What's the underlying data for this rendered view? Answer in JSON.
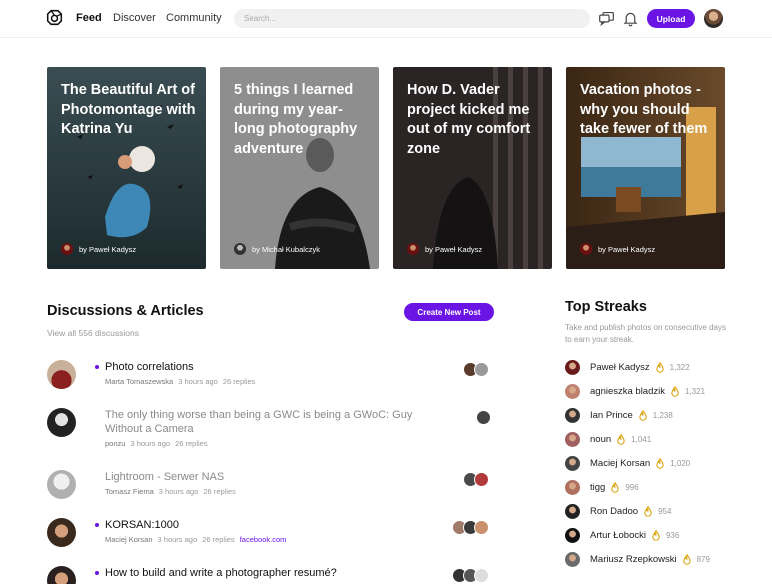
{
  "header": {
    "nav": [
      "Feed",
      "Discover",
      "Community"
    ],
    "search_placeholder": "Search...",
    "upload_label": "Upload"
  },
  "cards": [
    {
      "title": "The Beautiful Art of Photomontage with Katrina Yu",
      "author": "by Paweł Kadysz"
    },
    {
      "title": "5 things I learned during my year-long photography adventure",
      "author": "by Michał Kubalczyk"
    },
    {
      "title": "How D. Vader project kicked me out of my comfort zone",
      "author": "by Paweł Kadysz"
    },
    {
      "title": "Vacation photos - why you should take fewer of them",
      "author": "by Paweł Kadysz"
    }
  ],
  "discussions": {
    "title": "Discussions & Articles",
    "view_all": "View all 556 discussions",
    "create_label": "Create New Post",
    "items": [
      {
        "title": "Photo correlations",
        "author": "Marta Tomaszewska",
        "time": "3 hours ago",
        "replies": "26 replies",
        "unread": true
      },
      {
        "title": "The only thing worse than being a GWC is being a GWoC: Guy Without a Camera",
        "author": "ponzu",
        "time": "3 hours ago",
        "replies": "26 replies",
        "unread": false
      },
      {
        "title": "Lightroom - Serwer NAS",
        "author": "Tomasz Fiema",
        "time": "3 hours ago",
        "replies": "26 replies",
        "unread": false
      },
      {
        "title": "KORSAN:1000",
        "author": "Maciej Korsan",
        "time": "3 hours ago",
        "replies": "26 replies",
        "link": "facebook.com",
        "unread": true
      },
      {
        "title": "How to build and write a photographer resumé?",
        "unread": true
      }
    ]
  },
  "streaks": {
    "title": "Top Streaks",
    "subtitle": "Take and publish photos on consecutive days to earn your streak.",
    "items": [
      {
        "name": "Paweł Kadysz",
        "count": "1,322"
      },
      {
        "name": "agnieszka bladzik",
        "count": "1,321"
      },
      {
        "name": "Ian Prince",
        "count": "1,238"
      },
      {
        "name": "noun",
        "count": "1,041"
      },
      {
        "name": "Maciej Korsan",
        "count": "1,020"
      },
      {
        "name": "tigg",
        "count": "996"
      },
      {
        "name": "Ron Dadoo",
        "count": "954"
      },
      {
        "name": "Artur Łobocki",
        "count": "936"
      },
      {
        "name": "Mariusz Rzepkowski",
        "count": "879"
      }
    ]
  },
  "colors": {
    "accent": "#6a14e6",
    "flame": "#e0a800"
  },
  "icons": [
    "logo-icon",
    "messages-icon",
    "bell-icon",
    "flame-icon"
  ]
}
